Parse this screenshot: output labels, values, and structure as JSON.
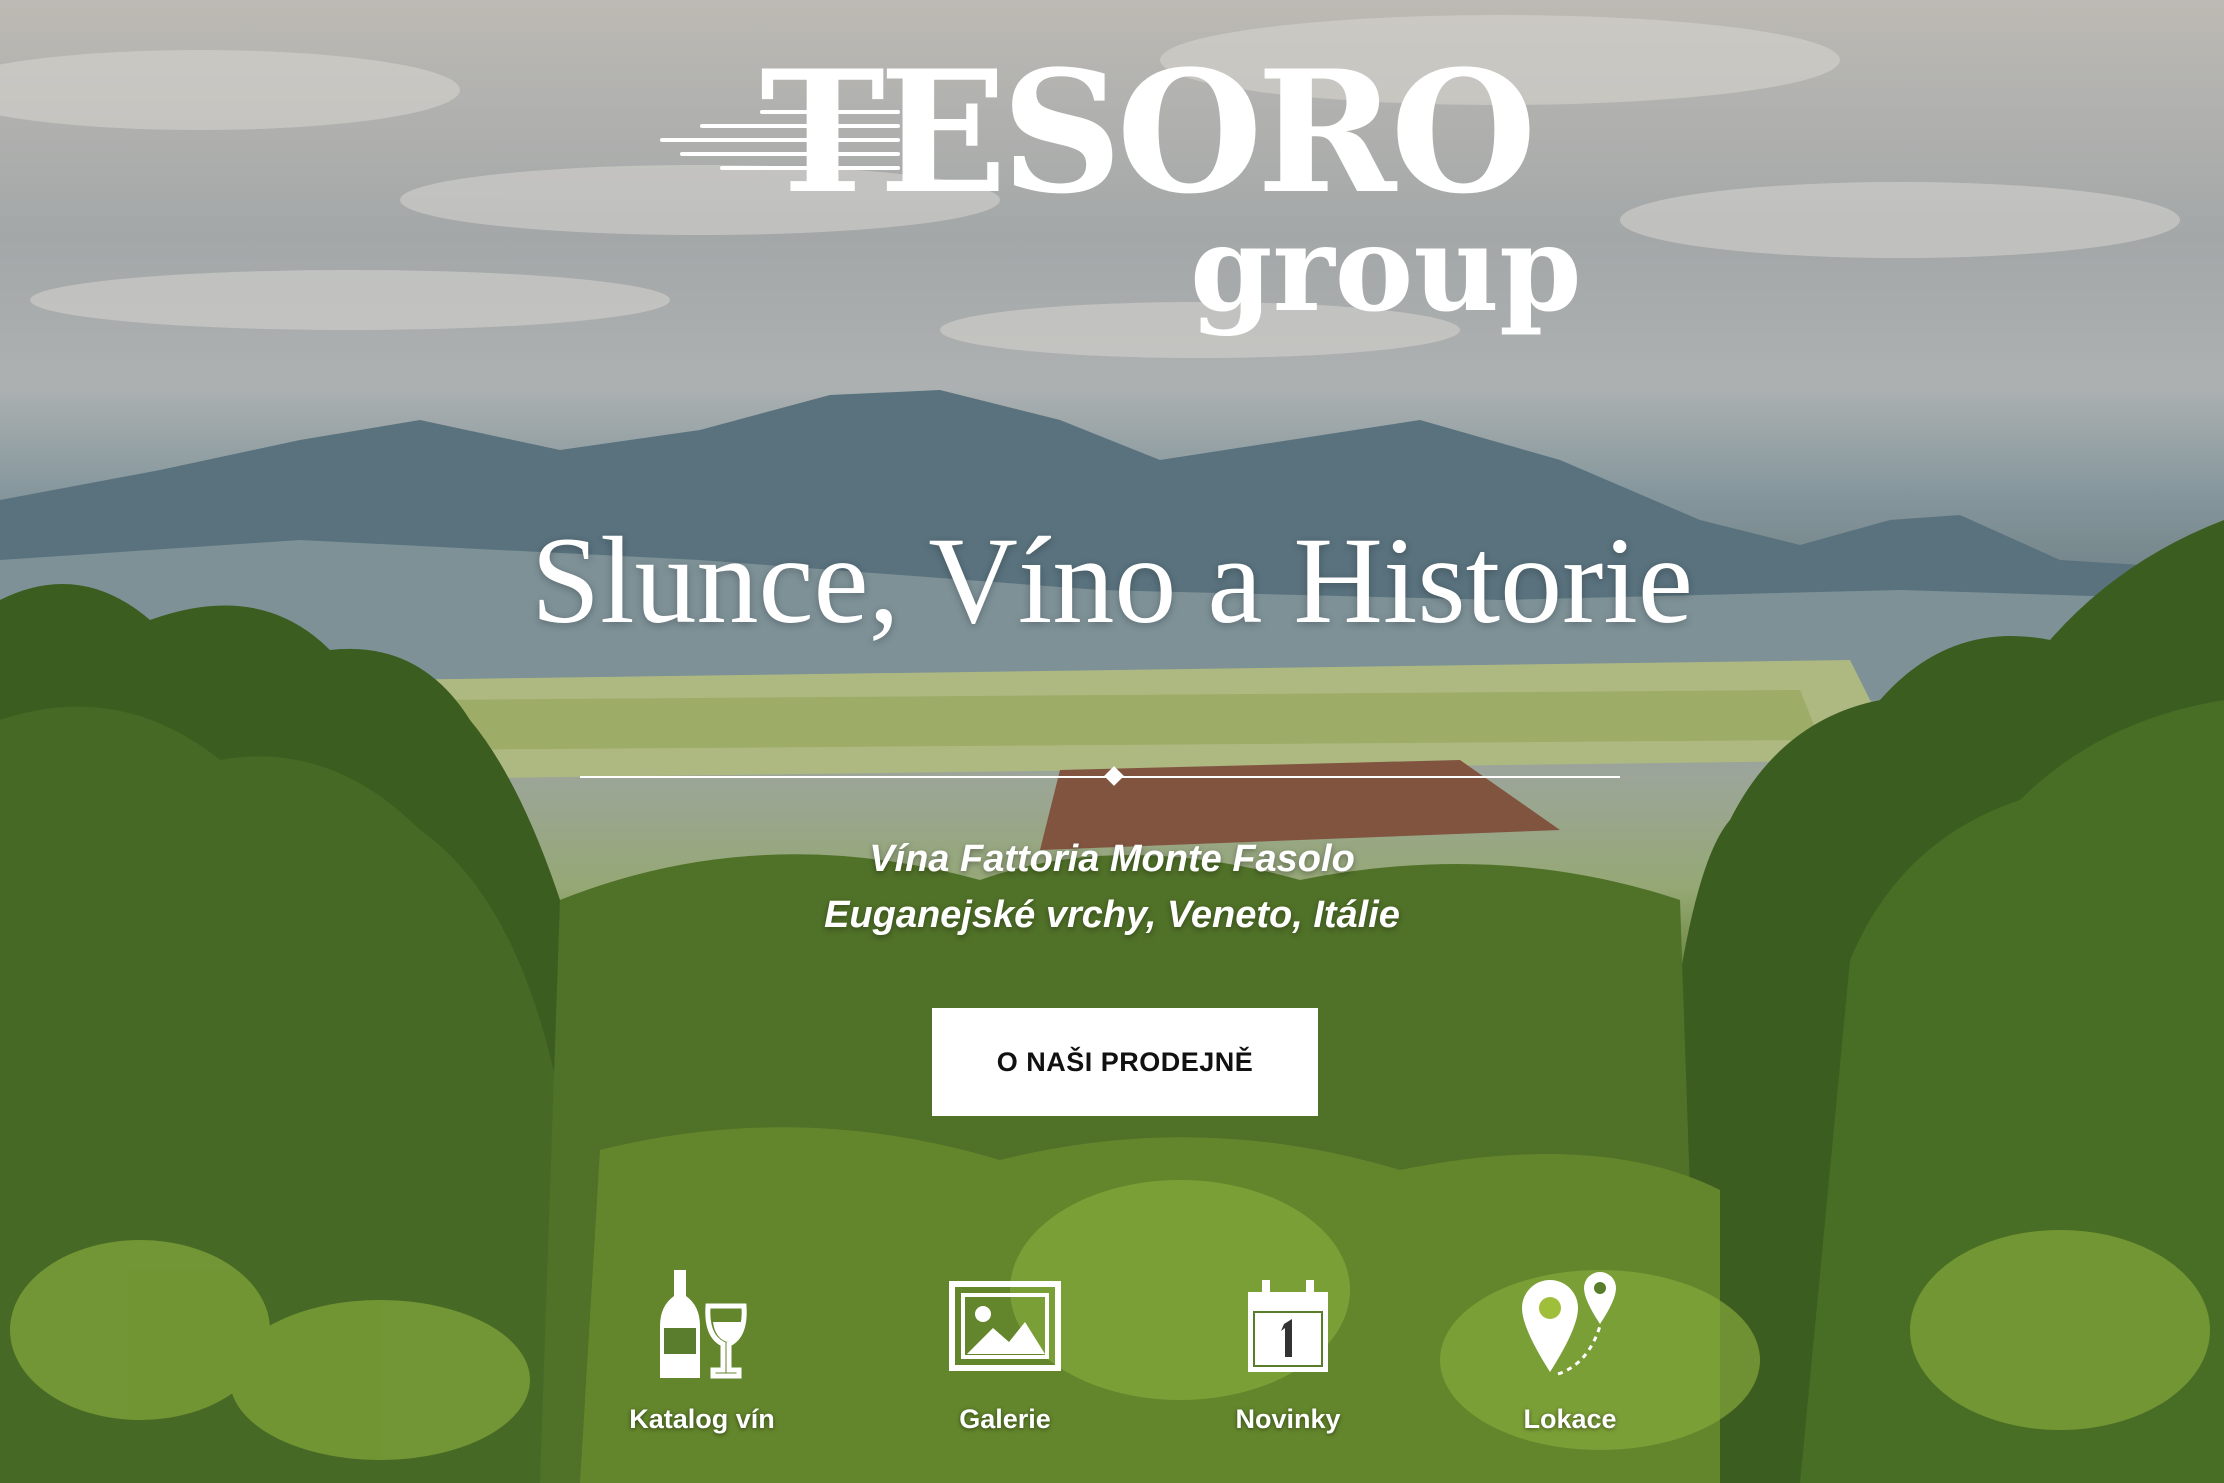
{
  "brand": {
    "name_main": "TESORO",
    "name_sub": "group"
  },
  "hero": {
    "headline": "Slunce, Víno a Historie",
    "subtitle_line1": "Vína Fattoria Monte Fasolo",
    "subtitle_line2": "Euganejské vrchy, Veneto, Itálie",
    "cta_label": "O NAŠI PRODEJNĚ"
  },
  "nav": [
    {
      "label": "Katalog vín",
      "icon": "wine-bottle-glass-icon"
    },
    {
      "label": "Galerie",
      "icon": "picture-gallery-icon"
    },
    {
      "label": "Novinky",
      "icon": "calendar-icon"
    },
    {
      "label": "Lokace",
      "icon": "map-pin-icon"
    }
  ],
  "colors": {
    "text": "#ffffff",
    "button_bg": "#ffffff",
    "button_text": "#111111"
  }
}
